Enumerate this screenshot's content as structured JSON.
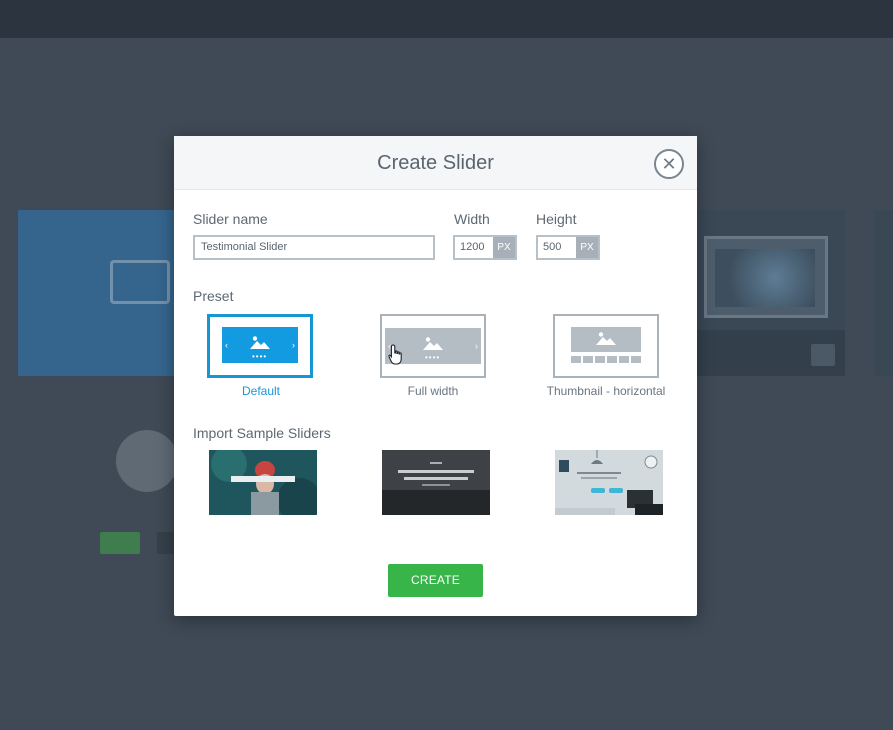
{
  "modal": {
    "title": "Create Slider",
    "close_symbol": "✕",
    "fields": {
      "slider_name_label": "Slider name",
      "slider_name_value": "Testimonial Slider",
      "width_label": "Width",
      "width_value": "1200",
      "width_unit": "PX",
      "height_label": "Height",
      "height_value": "500",
      "height_unit": "PX"
    },
    "preset": {
      "label": "Preset",
      "options": [
        {
          "label": "Default",
          "selected": true,
          "icon": "default-preset-icon"
        },
        {
          "label": "Full width",
          "selected": false,
          "icon": "full-width-preset-icon"
        },
        {
          "label": "Thumbnail - horizontal",
          "selected": false,
          "icon": "thumbnail-horizontal-preset-icon"
        }
      ]
    },
    "import_samples": {
      "label": "Import Sample Sliders"
    },
    "create_label": "CREATE"
  },
  "colors": {
    "accent": "#1796d6",
    "create_button": "#37b549",
    "overlay": "#3f4a56"
  }
}
